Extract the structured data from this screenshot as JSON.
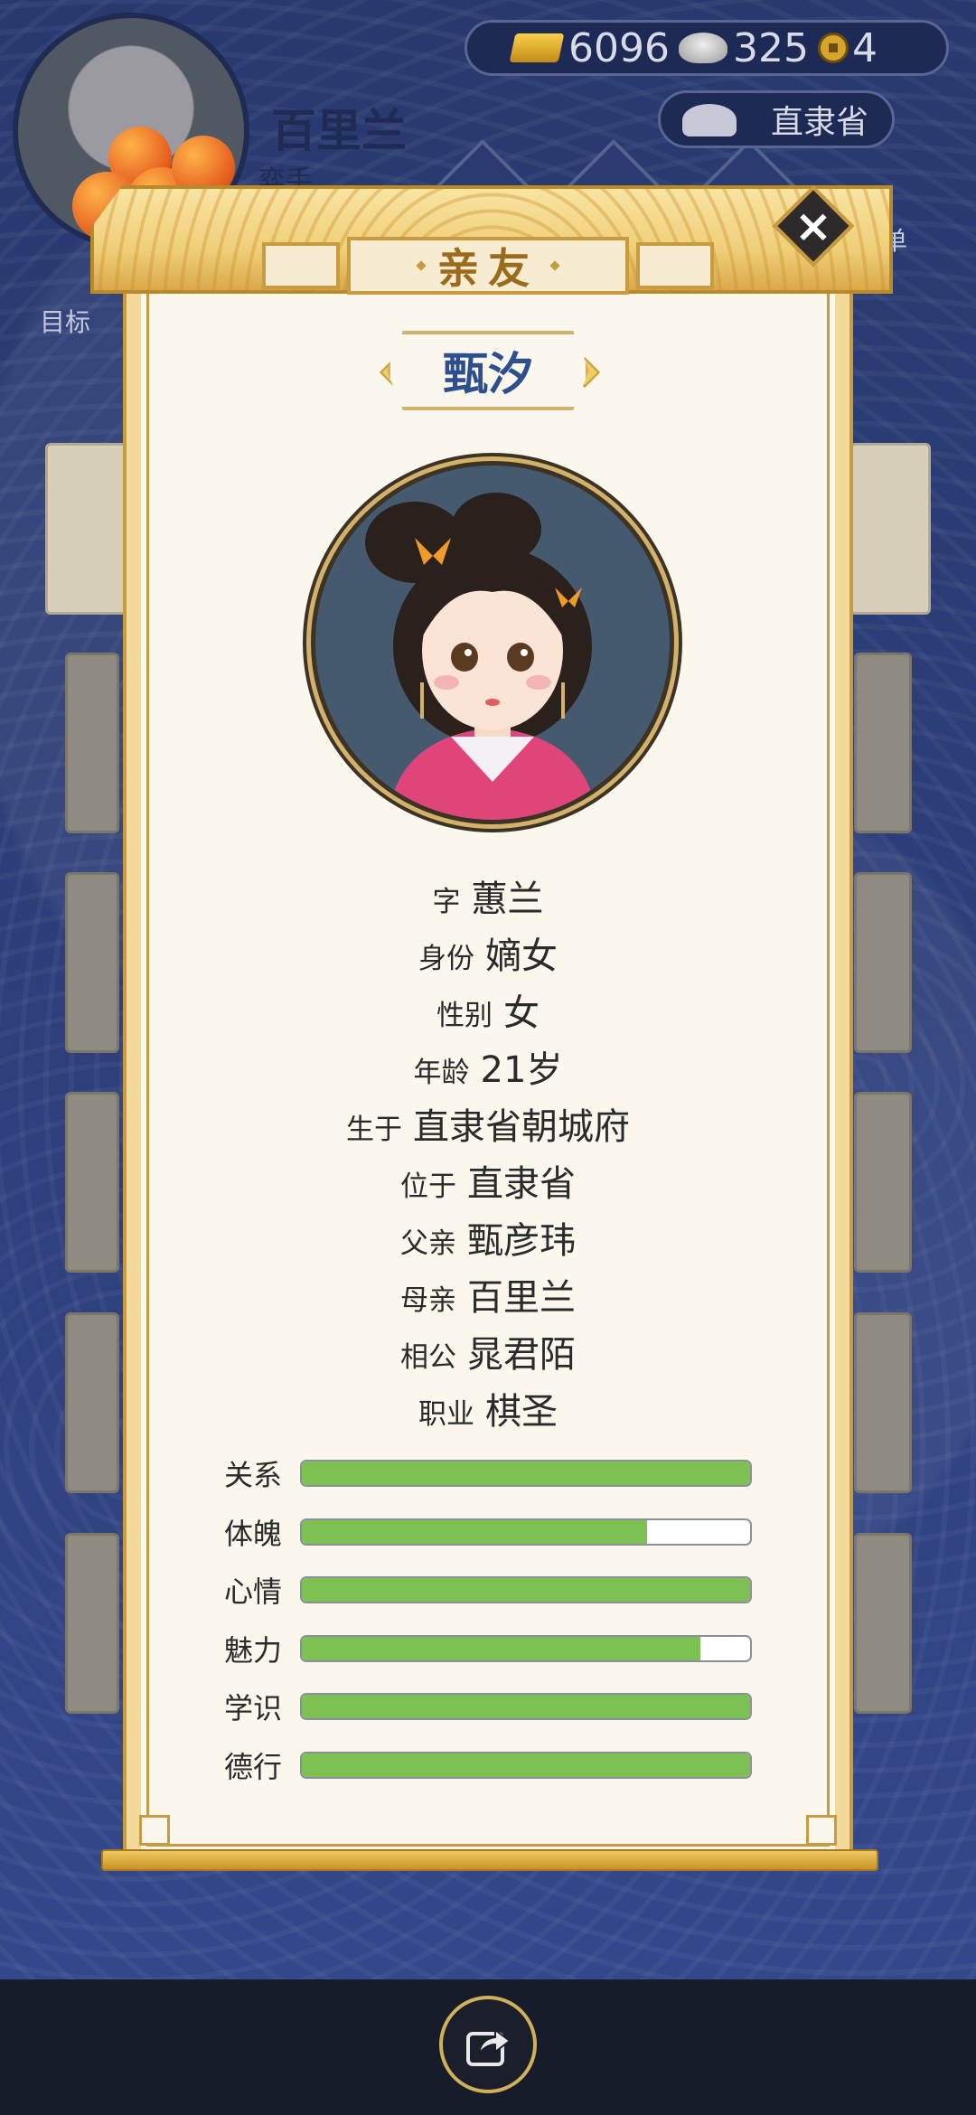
{
  "player": {
    "name": "百里兰",
    "title": "弈手",
    "goal_label": "目标",
    "menu_label": "菜单"
  },
  "currency": {
    "gold": "6096",
    "silver": "325",
    "coins": "4"
  },
  "location": "直隶省",
  "dialog": {
    "title": "亲友",
    "character_name": "甄汐",
    "info": [
      {
        "key": "字",
        "value": "蕙兰"
      },
      {
        "key": "身份",
        "value": "嫡女"
      },
      {
        "key": "性别",
        "value": "女"
      },
      {
        "key": "年龄",
        "value": "21岁"
      },
      {
        "key": "生于",
        "value": "直隶省朝城府"
      },
      {
        "key": "位于",
        "value": "直隶省"
      },
      {
        "key": "父亲",
        "value": "甄彦玮"
      },
      {
        "key": "母亲",
        "value": "百里兰"
      },
      {
        "key": "相公",
        "value": "晁君陌"
      },
      {
        "key": "职业",
        "value": "棋圣"
      }
    ],
    "stats": [
      {
        "label": "关系",
        "value": 1.0
      },
      {
        "label": "体魄",
        "value": 0.77
      },
      {
        "label": "心情",
        "value": 1.0
      },
      {
        "label": "魅力",
        "value": 0.89
      },
      {
        "label": "学识",
        "value": 1.0
      },
      {
        "label": "德行",
        "value": 1.0
      }
    ]
  },
  "colors": {
    "stat_fill": "#7dc153",
    "accent_gold": "#c89b40",
    "name_blue": "#2d4f8f"
  }
}
